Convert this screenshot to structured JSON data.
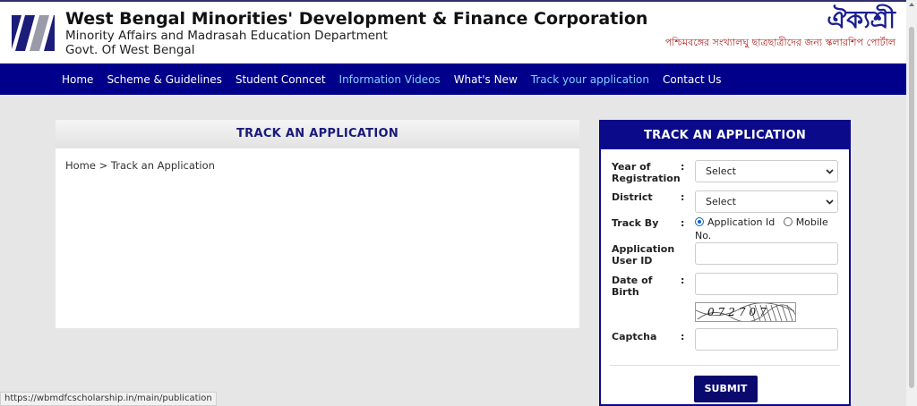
{
  "header": {
    "title": "West Bengal Minorities' Development & Finance Corporation",
    "subtitle1": "Minority Affairs and Madrasah Education Department",
    "subtitle2": "Govt. Of West Bengal",
    "brand_logo": "ঐক্যশ্রী",
    "brand_tagline": "পশ্চিমবঙ্গের সংখ্যালঘু ছাত্রছাত্রীদের জন্য স্কলারশিপ পোর্টাল"
  },
  "nav": {
    "items": [
      {
        "label": "Home",
        "active": false
      },
      {
        "label": "Scheme & Guidelines",
        "active": false
      },
      {
        "label": "Student Conncet",
        "active": false
      },
      {
        "label": "Information Videos",
        "active": true
      },
      {
        "label": "What's New",
        "active": false
      },
      {
        "label": "Track your application",
        "active": true
      },
      {
        "label": "Contact Us",
        "active": false
      }
    ]
  },
  "main": {
    "heading": "TRACK AN APPLICATION",
    "breadcrumb": {
      "home": "Home",
      "separator": ">",
      "current": "Track an Application"
    }
  },
  "form": {
    "heading": "TRACK AN APPLICATION",
    "year_label": "Year of Registration",
    "year_value": "Select",
    "district_label": "District",
    "district_value": "Select",
    "track_by_label": "Track By",
    "option_app_id": "Application Id",
    "option_mobile": "Mobile No.",
    "app_user_id_label": "Application User ID",
    "dob_label": "Date of Birth",
    "captcha_label": "Captcha",
    "captcha_image_text": "072707",
    "colon": ":",
    "submit_label": "SUBMIT"
  },
  "status_bar": {
    "url": "https://wbmdfcscholarship.in/main/publication"
  },
  "colors": {
    "nav_bg": "#00008b",
    "accent_link": "#7fd3ff",
    "form_header": "#0a0a8a",
    "submit_bg": "#0a0a6e",
    "brand_blue": "#1b1f8f",
    "tagline_red": "#b01e1e"
  }
}
